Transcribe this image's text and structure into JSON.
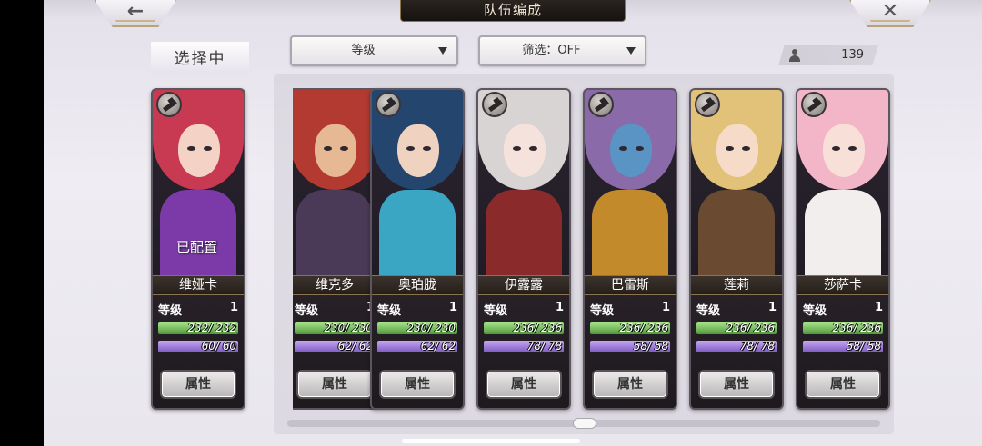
{
  "header": {
    "title": "队伍编成",
    "back_icon": "←",
    "close_icon": "✕"
  },
  "toolbar": {
    "selecting_label": "选择中",
    "sort_dropdown": "等级",
    "filter_dropdown": "筛选：OFF",
    "unit_count": "139"
  },
  "labels": {
    "level": "等级",
    "attributes_button": "属性",
    "assigned": "已配置"
  },
  "selected": {
    "name": "维娅卡",
    "level": "1",
    "hp": "232/ 232",
    "mp": "60/ 60",
    "hair_color": "#c83a52",
    "skin_color": "#f4d2c6",
    "outfit_color": "#7b3aa8"
  },
  "units": [
    {
      "name": "维克多",
      "level": "1",
      "hp": "230/ 230",
      "mp": "62/ 62",
      "hair_color": "#b23a30",
      "skin_color": "#e6b894",
      "outfit_color": "#4a3a58"
    },
    {
      "name": "奥珀胧",
      "level": "1",
      "hp": "230/ 230",
      "mp": "62/ 62",
      "hair_color": "#24466e",
      "skin_color": "#f0d2c0",
      "outfit_color": "#3aa6c4"
    },
    {
      "name": "伊露露",
      "level": "1",
      "hp": "236/ 236",
      "mp": "78/ 78",
      "hair_color": "#d8d4d4",
      "skin_color": "#f6e2dc",
      "outfit_color": "#8a2a2a"
    },
    {
      "name": "巴雷斯",
      "level": "1",
      "hp": "236/ 236",
      "mp": "58/ 58",
      "hair_color": "#8a6aa8",
      "skin_color": "#5a94c4",
      "outfit_color": "#c28a2a"
    },
    {
      "name": "莲莉",
      "level": "1",
      "hp": "236/ 236",
      "mp": "78/ 78",
      "hair_color": "#e2c278",
      "skin_color": "#f6dcc8",
      "outfit_color": "#6a4a30"
    },
    {
      "name": "莎萨卡",
      "level": "1",
      "hp": "236/ 236",
      "mp": "58/ 58",
      "hair_color": "#f2b6c8",
      "skin_color": "#f8e0d8",
      "outfit_color": "#f2eeee"
    }
  ]
}
